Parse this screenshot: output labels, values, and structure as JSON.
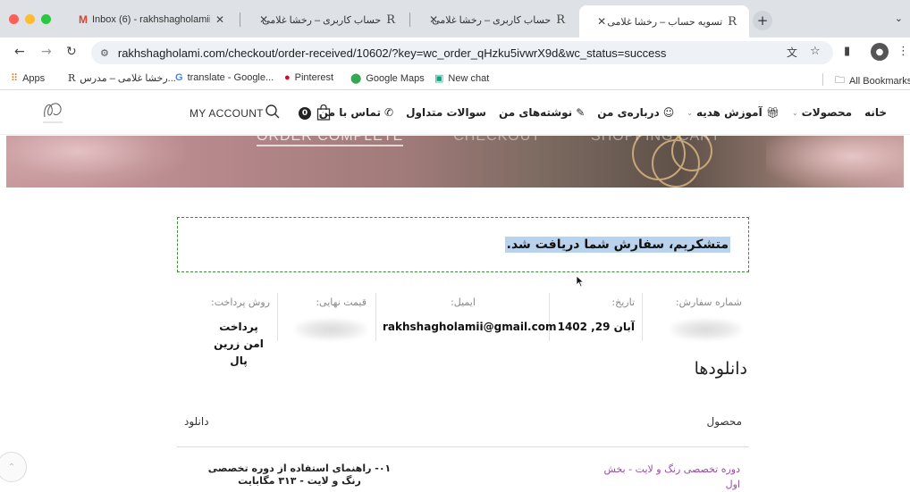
{
  "browser": {
    "tabs": [
      {
        "title": "Inbox (6) - rakhshagholamii@"
      },
      {
        "title": "حساب کاربری – رخشا غلامی"
      },
      {
        "title": "حساب کاربری – رخشا غلامی"
      },
      {
        "title": "تسویه حساب – رخشا غلامی"
      }
    ],
    "url": "rakhshagholami.com/checkout/order-received/10602/?key=wc_order_qHzku5ivwrX9d&wc_status=success",
    "bookmarks": [
      {
        "label": "Apps"
      },
      {
        "label": "رخشا غلامی – مدرس..."
      },
      {
        "label": "translate - Google..."
      },
      {
        "label": "Pinterest"
      },
      {
        "label": "Google Maps"
      },
      {
        "label": "New chat"
      }
    ],
    "all_bookmarks": "All Bookmarks"
  },
  "header": {
    "my_account": "MY ACCOUNT",
    "cart_count": "0",
    "menu": [
      {
        "label": "خانه"
      },
      {
        "label": "محصولات"
      },
      {
        "label": "آموزش هدیه"
      },
      {
        "label": "درباره‌ی من"
      },
      {
        "label": "نوشته‌های من"
      },
      {
        "label": "سوالات متداول"
      },
      {
        "label": "تماس با من"
      }
    ]
  },
  "banner": {
    "steps": [
      "ORDER COMPLETE",
      "CHECKOUT",
      "SHOPPING CART"
    ]
  },
  "notice": {
    "text": "متشکریم، سفارش شما دریافت شد."
  },
  "order": {
    "number_label": "شماره سفارش:",
    "date_label": "تاریخ:",
    "date_value": "آبان 29, 1402",
    "email_label": "ایمیل:",
    "email_value": "rakhshagholamii@gmail.com",
    "total_label": "قیمت نهایی:",
    "payment_label": "روش پرداخت:",
    "payment_value": "پرداخت امن زرین پال"
  },
  "downloads": {
    "title": "دانلودها",
    "col_product": "محصول",
    "col_download": "دانلود",
    "rows": [
      {
        "product": "دوره تخصصی رنگ و لایت - بخش اول",
        "file": "۰۱- راهنمای استفاده از دوره تخصصی رنگ و لایت - ۳۱۳ مگابایت"
      }
    ]
  }
}
